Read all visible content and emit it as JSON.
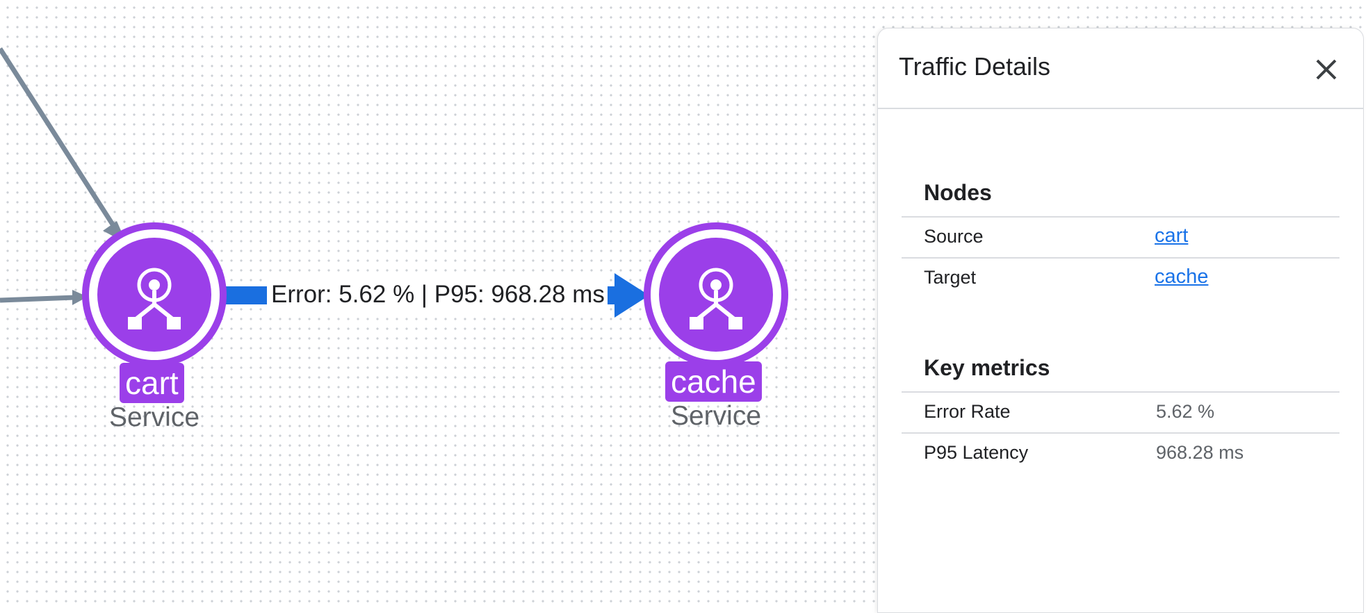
{
  "graph": {
    "edge_label": "Error: 5.62 % | P95: 968.28 ms",
    "nodes": [
      {
        "name": "cart",
        "type": "Service",
        "icon": "service-icon"
      },
      {
        "name": "cache",
        "type": "Service",
        "icon": "service-icon"
      }
    ],
    "colors": {
      "node": "#9b3fe9",
      "edge_active": "#1a6fe0",
      "edge_inactive": "#7a8a9a"
    }
  },
  "panel": {
    "title": "Traffic Details",
    "close_icon": "close-icon",
    "nodes_section": {
      "title": "Nodes",
      "rows": [
        {
          "key": "Source",
          "value": "cart"
        },
        {
          "key": "Target",
          "value": "cache"
        }
      ]
    },
    "metrics_section": {
      "title": "Key metrics",
      "rows": [
        {
          "key": "Error Rate",
          "value": "5.62 %"
        },
        {
          "key": "P95 Latency",
          "value": "968.28 ms"
        }
      ]
    }
  }
}
